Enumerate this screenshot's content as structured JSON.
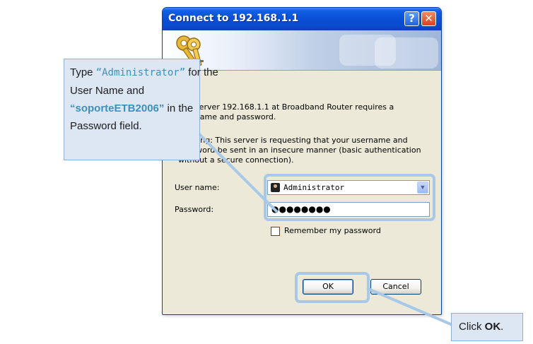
{
  "dialog": {
    "title": "Connect to 192.168.1.1",
    "help_glyph": "?",
    "close_glyph": "✕",
    "server_message": "The server 192.168.1.1 at Broadband Router requires a username and password.",
    "warning_message": "Warning: This server is requesting that your username and password be sent in an insecure manner (basic authentication without a secure connection).",
    "username_label": "User name:",
    "username_value": "Administrator",
    "password_label": "Password:",
    "password_value": "●●●●●●●●",
    "remember_label": "Remember my password",
    "ok_label": "OK",
    "cancel_label": "Cancel"
  },
  "callouts": {
    "main": {
      "line1_prefix": "Type ",
      "line1_quote": "“Administrator”",
      "line1_suffix": " for the",
      "line2": "User Name and",
      "line3_quote": "“soporteETB2006”",
      "line3_suffix": " in the",
      "line4": "Password field."
    },
    "ok": {
      "prefix": "Click ",
      "emphasis": "OK",
      "suffix": "."
    }
  },
  "colors": {
    "titlebar": "#0a4fd6",
    "dialog_face": "#ece9d8",
    "highlight": "#a8c8e8",
    "callout_fill": "#dce7f3",
    "callout_accent": "#3d8fbe"
  }
}
